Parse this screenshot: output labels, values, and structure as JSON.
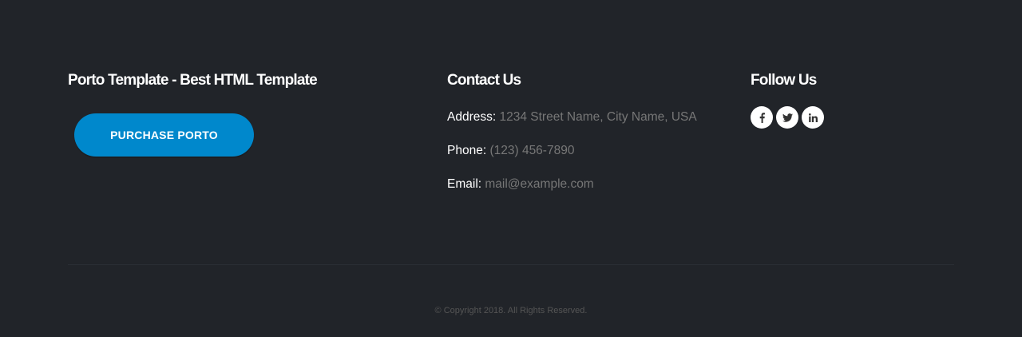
{
  "brand": {
    "heading": "Porto Template - Best HTML Template",
    "purchase_label": "PURCHASE PORTO"
  },
  "contact": {
    "heading": "Contact Us",
    "items": [
      {
        "label": "Address:",
        "value": "1234 Street Name, City Name, USA"
      },
      {
        "label": "Phone:",
        "value": "(123) 456-7890"
      },
      {
        "label": "Email:",
        "value": "mail@example.com"
      }
    ]
  },
  "follow": {
    "heading": "Follow Us",
    "icons": [
      "facebook-icon",
      "twitter-icon",
      "linkedin-icon"
    ]
  },
  "footer": {
    "copyright": "© Copyright 2018. All Rights Reserved."
  },
  "colors": {
    "background": "#212429",
    "accent": "#0088cc",
    "muted_text": "#777777",
    "heading_text": "#ffffff"
  }
}
